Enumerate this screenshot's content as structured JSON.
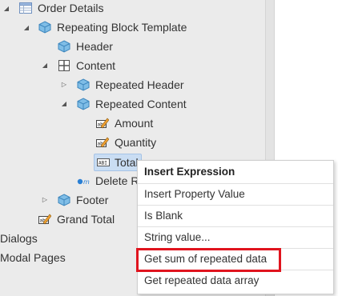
{
  "tree": {
    "items": [
      {
        "label": "Order Details",
        "icon": "table-icon",
        "toggle": "expanded"
      },
      {
        "label": "Repeating Block Template",
        "icon": "cube-icon",
        "toggle": "expanded"
      },
      {
        "label": "Header",
        "icon": "cube-icon",
        "toggle": "none"
      },
      {
        "label": "Content",
        "icon": "grid-icon",
        "toggle": "expanded"
      },
      {
        "label": "Repeated Header",
        "icon": "cube-icon",
        "toggle": "collapsed"
      },
      {
        "label": "Repeated Content",
        "icon": "cube-icon",
        "toggle": "expanded"
      },
      {
        "label": "Amount",
        "icon": "edit-field-icon",
        "toggle": "none"
      },
      {
        "label": "Quantity",
        "icon": "edit-field-icon",
        "toggle": "none"
      },
      {
        "label": "Total",
        "icon": "text-field-icon",
        "toggle": "none"
      },
      {
        "label": "Delete R",
        "icon": "delete-link-icon",
        "toggle": "none"
      },
      {
        "label": "Footer",
        "icon": "cube-icon",
        "toggle": "collapsed"
      },
      {
        "label": "Grand Total",
        "icon": "edit-field-icon",
        "toggle": "none"
      },
      {
        "label": "Dialogs",
        "icon": "",
        "toggle": "none"
      },
      {
        "label": "Modal Pages",
        "icon": "",
        "toggle": "none"
      }
    ]
  },
  "context_menu": {
    "header": "Insert Expression",
    "items": [
      "Insert Property Value",
      "Is Blank",
      "String value...",
      "Get sum of repeated data",
      "Get repeated data array"
    ],
    "highlighted_item": "Get sum of repeated data"
  },
  "colors": {
    "highlight_border": "#e0141e",
    "selection": "#c9ddf3",
    "cube": "#5aa6d8"
  }
}
